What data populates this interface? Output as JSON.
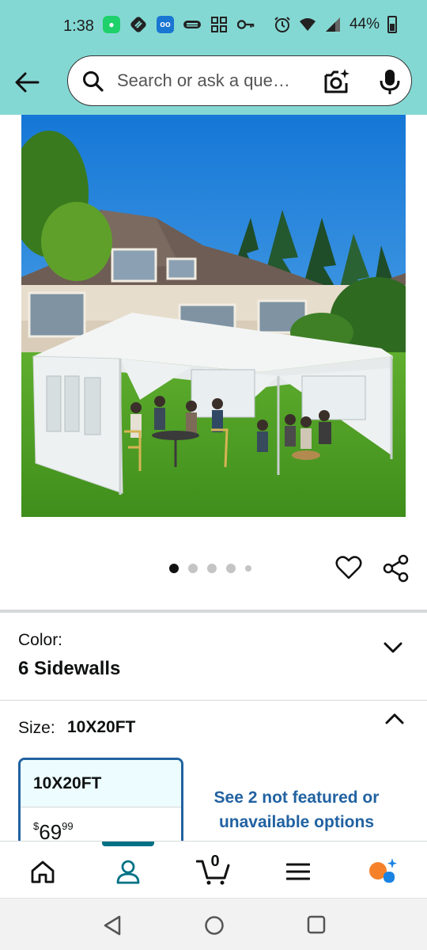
{
  "status_bar": {
    "time": "1:38",
    "battery": "44%",
    "icons": [
      "messages-icon",
      "link-icon",
      "voicemail-icon",
      "news-icon",
      "grid-icon",
      "key-icon",
      "alarm-icon",
      "wifi-icon",
      "signal-icon",
      "battery-icon"
    ]
  },
  "search": {
    "placeholder": "Search or ask a que…"
  },
  "carousel": {
    "image_count": 5,
    "active_index": 0
  },
  "color": {
    "label": "Color:",
    "value": "6 Sidewalls"
  },
  "size": {
    "label": "Size:",
    "value": "10X20FT",
    "options": [
      {
        "name": "10X20FT",
        "price_symbol": "$",
        "price_whole": "69",
        "price_fraction": "99"
      }
    ],
    "more_link": "See 2 not featured or unavailable options"
  },
  "bottom_nav": {
    "items": [
      "home-icon",
      "account-icon",
      "cart-icon",
      "menu-icon",
      "rufus-icon"
    ],
    "active": "account-icon",
    "cart_count": "0"
  },
  "colors": {
    "header_bg": "#84d8d3",
    "link": "#2162a1",
    "active_tab": "#007185",
    "selected_card_bg": "#edfdff"
  }
}
